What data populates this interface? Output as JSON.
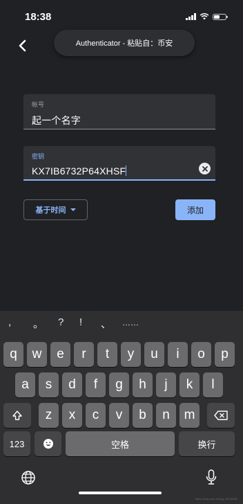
{
  "status_bar": {
    "time": "18:38"
  },
  "banner": {
    "text": "Authenticator - 粘贴自：币安"
  },
  "form": {
    "account": {
      "label": "帐号",
      "value": "起一个名字"
    },
    "secret": {
      "label": "密钥",
      "value": "KX7IB6732P64XHSF"
    },
    "type_dropdown": {
      "value": "基于时间"
    },
    "add_button": {
      "label": "添加"
    }
  },
  "keyboard": {
    "punctuation": [
      ",",
      "。",
      "?",
      "!",
      "、",
      "……"
    ],
    "row1": [
      "q",
      "w",
      "e",
      "r",
      "t",
      "y",
      "u",
      "i",
      "o",
      "p"
    ],
    "row2": [
      "a",
      "s",
      "d",
      "f",
      "g",
      "h",
      "j",
      "k",
      "l"
    ],
    "row3": [
      "z",
      "x",
      "c",
      "v",
      "b",
      "n",
      "m"
    ],
    "numbers_key": "123",
    "space_key": "空格",
    "return_key": "换行"
  },
  "watermark": "https://blog.csdn.net/qq_45218050",
  "colors": {
    "accent": "#8ab4f8",
    "background": "#202124",
    "field": "#303236",
    "key": "#6b6b6e"
  }
}
